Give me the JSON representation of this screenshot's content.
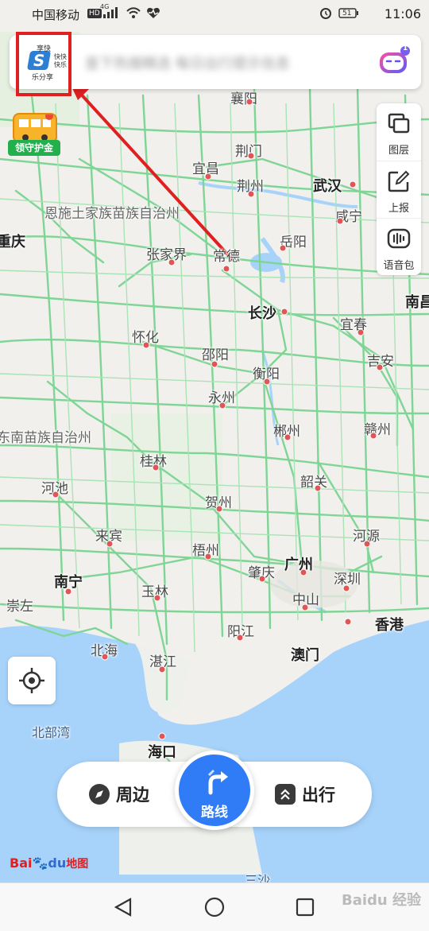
{
  "status_bar": {
    "carrier": "中国移动",
    "network_badge": "HD",
    "network_type": "4G",
    "battery": "51",
    "time": "11:06"
  },
  "search": {
    "avatar_text": [
      "享快",
      "乐分享",
      "快快",
      "快乐"
    ],
    "avatar_letter": "S",
    "placeholder_blurred": "查下热搜精选   每日出行提示信息",
    "assistant_badge": "1"
  },
  "promo": {
    "label": "领守护金"
  },
  "toolbar": {
    "layers_label": "图层",
    "report_label": "上报",
    "voice_label": "语音包"
  },
  "map": {
    "cities": [
      {
        "name": "襄阳",
        "cls": ""
      },
      {
        "name": "荆门",
        "cls": ""
      },
      {
        "name": "宜昌",
        "cls": ""
      },
      {
        "name": "荆州",
        "cls": ""
      },
      {
        "name": "武汉",
        "cls": "big"
      },
      {
        "name": "恩施土家族苗族自治州",
        "cls": "region"
      },
      {
        "name": "咸宁",
        "cls": ""
      },
      {
        "name": "重庆",
        "cls": "big"
      },
      {
        "name": "张家界",
        "cls": ""
      },
      {
        "name": "常德",
        "cls": ""
      },
      {
        "name": "岳阳",
        "cls": ""
      },
      {
        "name": "南昌",
        "cls": "big"
      },
      {
        "name": "长沙",
        "cls": "big"
      },
      {
        "name": "宜春",
        "cls": ""
      },
      {
        "name": "怀化",
        "cls": ""
      },
      {
        "name": "邵阳",
        "cls": ""
      },
      {
        "name": "衡阳",
        "cls": ""
      },
      {
        "name": "吉安",
        "cls": ""
      },
      {
        "name": "永州",
        "cls": ""
      },
      {
        "name": "郴州",
        "cls": ""
      },
      {
        "name": "赣州",
        "cls": ""
      },
      {
        "name": "东南苗族自治州",
        "cls": "region"
      },
      {
        "name": "桂林",
        "cls": ""
      },
      {
        "name": "韶关",
        "cls": ""
      },
      {
        "name": "河池",
        "cls": ""
      },
      {
        "name": "贺州",
        "cls": ""
      },
      {
        "name": "来宾",
        "cls": ""
      },
      {
        "name": "河源",
        "cls": ""
      },
      {
        "name": "梧州",
        "cls": ""
      },
      {
        "name": "广州",
        "cls": "big"
      },
      {
        "name": "南宁",
        "cls": "big"
      },
      {
        "name": "肇庆",
        "cls": ""
      },
      {
        "name": "深圳",
        "cls": ""
      },
      {
        "name": "玉林",
        "cls": ""
      },
      {
        "name": "中山",
        "cls": ""
      },
      {
        "name": "崇左",
        "cls": ""
      },
      {
        "name": "香港",
        "cls": "big"
      },
      {
        "name": "阳江",
        "cls": ""
      },
      {
        "name": "北海",
        "cls": ""
      },
      {
        "name": "澳门",
        "cls": "big"
      },
      {
        "name": "湛江",
        "cls": ""
      },
      {
        "name": "北部湾",
        "cls": "sea"
      },
      {
        "name": "海口",
        "cls": "big"
      },
      {
        "name": "三沙",
        "cls": "sea"
      }
    ]
  },
  "bottom": {
    "nearby_label": "周边",
    "route_label": "路线",
    "travel_label": "出行"
  },
  "logo": {
    "brand": "Bai",
    "brand2": "du",
    "suffix": "地图"
  },
  "watermark": "Baidu 经验"
}
